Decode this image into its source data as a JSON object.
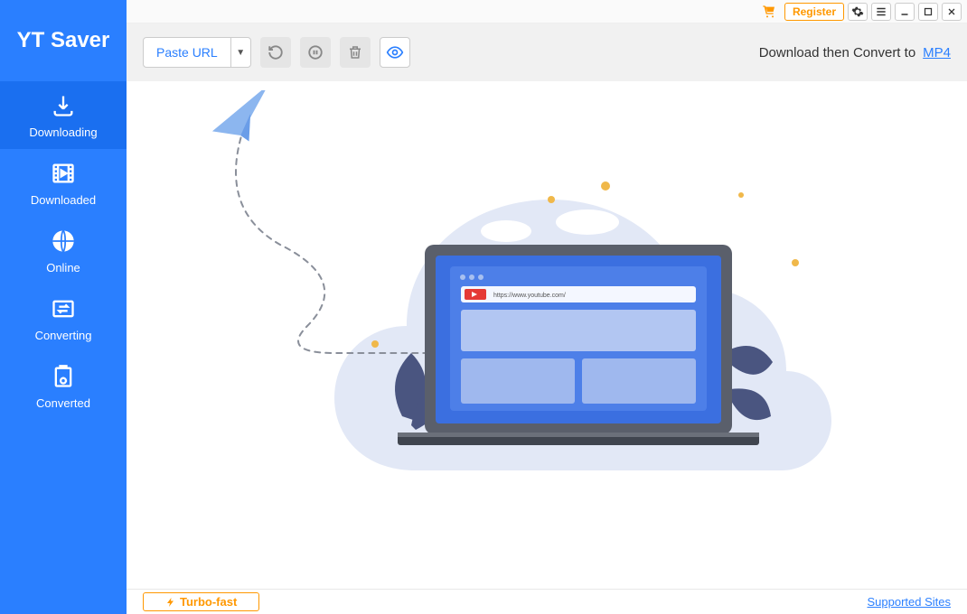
{
  "app_name": "YT Saver",
  "titlebar": {
    "register": "Register"
  },
  "sidebar": {
    "items": [
      {
        "label": "Downloading"
      },
      {
        "label": "Downloaded"
      },
      {
        "label": "Online"
      },
      {
        "label": "Converting"
      },
      {
        "label": "Converted"
      }
    ]
  },
  "toolbar": {
    "paste_label": "Paste URL",
    "convert_text": "Download then Convert to",
    "format": "MP4"
  },
  "illustration": {
    "browser_url": "https://www.youtube.com/"
  },
  "footer": {
    "turbo": "Turbo-fast",
    "supported": "Supported Sites"
  }
}
